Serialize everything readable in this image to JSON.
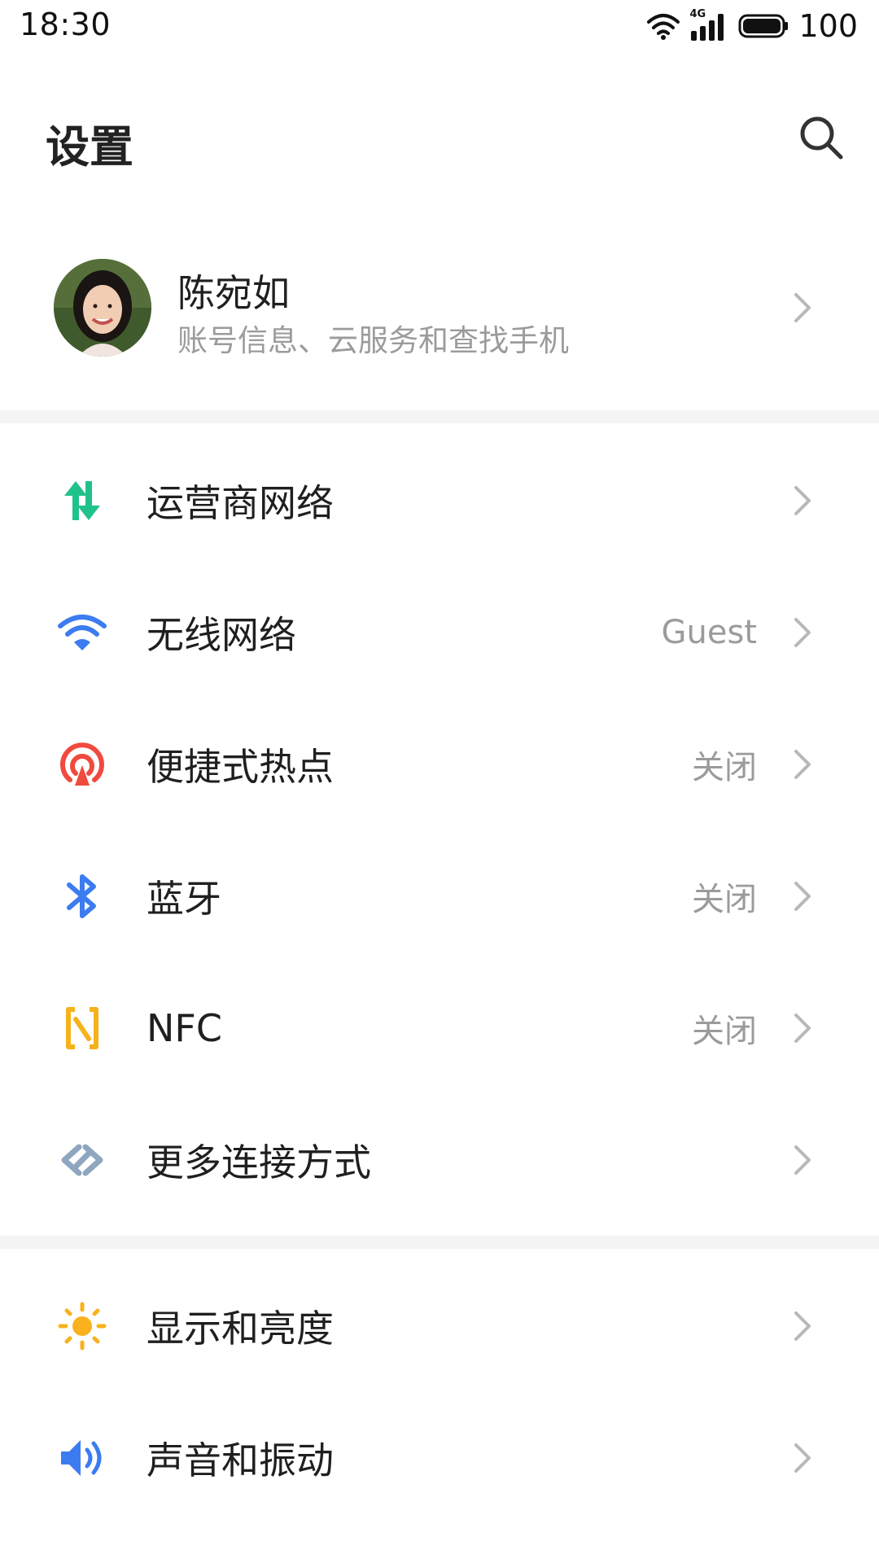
{
  "status_bar": {
    "time": "18:30",
    "network_type": "4G",
    "battery": "100"
  },
  "header": {
    "title": "设置"
  },
  "account": {
    "name": "陈宛如",
    "subtitle": "账号信息、云服务和查找手机"
  },
  "section1": [
    {
      "label": "运营商网络",
      "value": "",
      "icon": "transfer-arrows-icon",
      "color": "#1fc28a"
    },
    {
      "label": "无线网络",
      "value": "Guest",
      "icon": "wifi-icon",
      "color": "#3c7cf0"
    },
    {
      "label": "便捷式热点",
      "value": "关闭",
      "icon": "hotspot-icon",
      "color": "#f04a3f"
    },
    {
      "label": "蓝牙",
      "value": "关闭",
      "icon": "bluetooth-icon",
      "color": "#3c7cf0"
    },
    {
      "label": "NFC",
      "value": "关闭",
      "icon": "nfc-icon",
      "color": "#f5b21b"
    },
    {
      "label": "更多连接方式",
      "value": "",
      "icon": "link-icon",
      "color": "#8fa6bf"
    }
  ],
  "section2": [
    {
      "label": "显示和亮度",
      "value": "",
      "icon": "sun-icon",
      "color": "#f9b21d"
    },
    {
      "label": "声音和振动",
      "value": "",
      "icon": "speaker-icon",
      "color": "#3c7cf0"
    }
  ]
}
